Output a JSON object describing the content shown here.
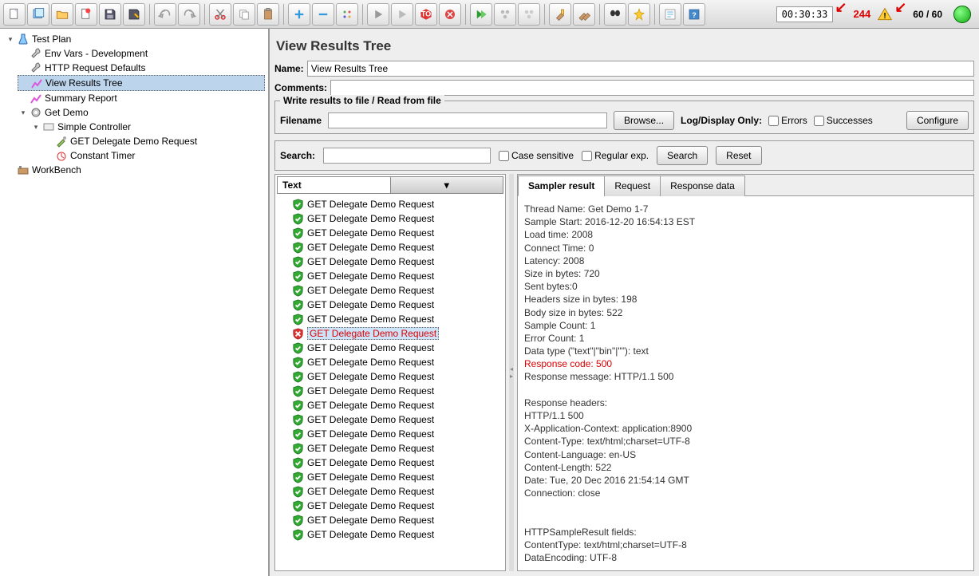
{
  "toolbar": {
    "timer": "00:30:33",
    "error_count": "244",
    "threads": "60 / 60"
  },
  "tree": {
    "test_plan": "Test Plan",
    "env_vars": "Env Vars - Development",
    "http_defaults": "HTTP Request Defaults",
    "view_results": "View Results Tree",
    "summary_report": "Summary Report",
    "get_demo": "Get Demo",
    "simple_controller": "Simple Controller",
    "get_delegate": "GET Delegate Demo Request",
    "constant_timer": "Constant Timer",
    "workbench": "WorkBench"
  },
  "panel": {
    "title": "View Results Tree",
    "name_label": "Name:",
    "name_value": "View Results Tree",
    "comments_label": "Comments:",
    "file_legend": "Write results to file / Read from file",
    "filename_label": "Filename",
    "browse": "Browse...",
    "log_display": "Log/Display Only:",
    "errors": "Errors",
    "successes": "Successes",
    "configure": "Configure"
  },
  "search": {
    "label": "Search:",
    "case_sensitive": "Case sensitive",
    "regex": "Regular exp.",
    "search_btn": "Search",
    "reset_btn": "Reset"
  },
  "results": {
    "dropdown": "Text",
    "item_label": "GET Delegate Demo Request",
    "items": [
      {
        "ok": true
      },
      {
        "ok": true
      },
      {
        "ok": true
      },
      {
        "ok": true
      },
      {
        "ok": true
      },
      {
        "ok": true
      },
      {
        "ok": true
      },
      {
        "ok": true
      },
      {
        "ok": true
      },
      {
        "ok": false
      },
      {
        "ok": true
      },
      {
        "ok": true
      },
      {
        "ok": true
      },
      {
        "ok": true
      },
      {
        "ok": true
      },
      {
        "ok": true
      },
      {
        "ok": true
      },
      {
        "ok": true
      },
      {
        "ok": true
      },
      {
        "ok": true
      },
      {
        "ok": true
      },
      {
        "ok": true
      },
      {
        "ok": true
      },
      {
        "ok": true
      }
    ]
  },
  "tabs": {
    "sampler": "Sampler result",
    "request": "Request",
    "response": "Response data"
  },
  "detail": {
    "lines": [
      "Thread Name: Get Demo 1-7",
      "Sample Start: 2016-12-20 16:54:13 EST",
      "Load time: 2008",
      "Connect Time: 0",
      "Latency: 2008",
      "Size in bytes: 720",
      "Sent bytes:0",
      "Headers size in bytes: 198",
      "Body size in bytes: 522",
      "Sample Count: 1",
      "Error Count: 1",
      "Data type (\"text\"|\"bin\"|\"\"): text"
    ],
    "response_code": "Response code: 500",
    "response_msg": "Response message: HTTP/1.1 500",
    "headers_title": "Response headers:",
    "headers": [
      "HTTP/1.1 500",
      "X-Application-Context: application:8900",
      "Content-Type: text/html;charset=UTF-8",
      "Content-Language: en-US",
      "Content-Length: 522",
      "Date: Tue, 20 Dec 2016 21:54:14 GMT",
      "Connection: close"
    ],
    "fields_title": "HTTPSampleResult fields:",
    "fields": [
      "ContentType: text/html;charset=UTF-8",
      "DataEncoding: UTF-8"
    ]
  }
}
